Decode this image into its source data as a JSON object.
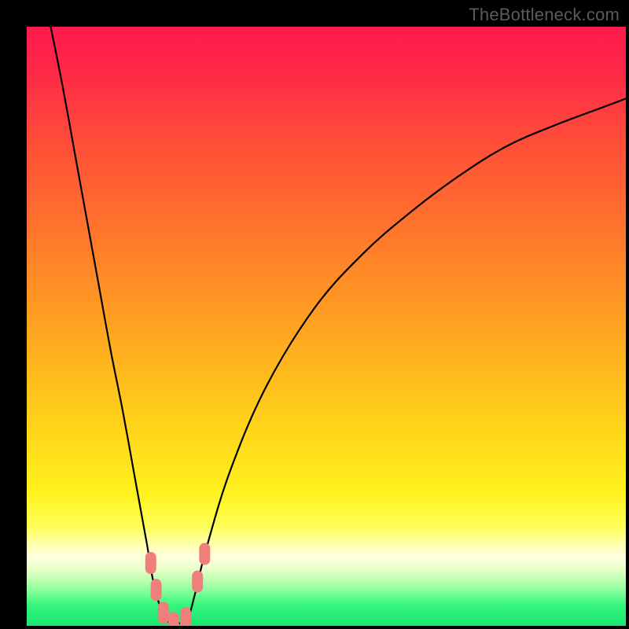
{
  "watermark": "TheBottleneck.com",
  "colors": {
    "black": "#000000",
    "curve": "#000000",
    "marker": "#ef7f7a",
    "marker_stroke": "#ef7f7a"
  },
  "gradient_stops": [
    {
      "offset": 0.0,
      "color": "#ff1a4d"
    },
    {
      "offset": 0.08,
      "color": "#ff2a47"
    },
    {
      "offset": 0.18,
      "color": "#ff4a3a"
    },
    {
      "offset": 0.3,
      "color": "#ff6a2f"
    },
    {
      "offset": 0.42,
      "color": "#ff8c26"
    },
    {
      "offset": 0.55,
      "color": "#ffb11e"
    },
    {
      "offset": 0.68,
      "color": "#ffd71a"
    },
    {
      "offset": 0.78,
      "color": "#fff21e"
    },
    {
      "offset": 0.835,
      "color": "#ffff5a"
    },
    {
      "offset": 0.865,
      "color": "#ffffb0"
    },
    {
      "offset": 0.885,
      "color": "#ffffe0"
    },
    {
      "offset": 0.905,
      "color": "#e8ffc8"
    },
    {
      "offset": 0.925,
      "color": "#b8ffb0"
    },
    {
      "offset": 0.945,
      "color": "#7dff96"
    },
    {
      "offset": 0.965,
      "color": "#35f57d"
    },
    {
      "offset": 1.0,
      "color": "#18e56e"
    }
  ],
  "chart_data": {
    "type": "line",
    "title": "",
    "xlabel": "",
    "ylabel": "",
    "xlim": [
      0,
      100
    ],
    "ylim": [
      0,
      100
    ],
    "series": [
      {
        "name": "bottleneck-curve",
        "x": [
          4,
          6,
          8,
          10,
          12,
          14,
          16,
          18,
          20,
          21,
          22,
          23,
          24,
          25,
          26,
          27,
          28,
          30,
          34,
          40,
          48,
          56,
          64,
          72,
          80,
          88,
          96,
          100
        ],
        "y": [
          100,
          90,
          79,
          68,
          57,
          46,
          36,
          25,
          14,
          8,
          4,
          1.3,
          0.5,
          0.5,
          0.5,
          1.5,
          5,
          13,
          26,
          40,
          53,
          62,
          69,
          75,
          80,
          83.5,
          86.5,
          88
        ]
      }
    ],
    "markers": [
      {
        "x": 20.7,
        "y": 10.5
      },
      {
        "x": 21.6,
        "y": 6.0
      },
      {
        "x": 22.8,
        "y": 2.2
      },
      {
        "x": 24.5,
        "y": 0.5
      },
      {
        "x": 26.5,
        "y": 1.3
      },
      {
        "x": 28.5,
        "y": 7.4
      },
      {
        "x": 29.7,
        "y": 12.0
      }
    ]
  }
}
